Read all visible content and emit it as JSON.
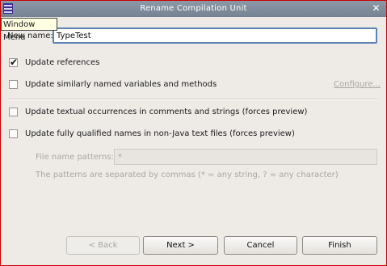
{
  "window": {
    "title": "Rename Compilation Unit",
    "menu_tooltip": "Window Menu",
    "close_glyph": "✕"
  },
  "form": {
    "new_name_label": "New name:",
    "new_name_value": "TypeTest",
    "options": [
      {
        "label": "Update references",
        "checked": true
      },
      {
        "label": "Update similarly named variables and methods",
        "checked": false
      },
      {
        "label": "Update textual occurrences in comments and strings (forces preview)",
        "checked": false
      },
      {
        "label": "Update fully qualified names in non-Java text files (forces preview)",
        "checked": false
      }
    ],
    "configure_link": "Configure...",
    "file_patterns_label": "File name patterns:",
    "file_patterns_value": "*",
    "patterns_hint": "The patterns are separated by commas (* = any string, ? = any character)"
  },
  "buttons": {
    "back": "< Back",
    "next": "Next >",
    "cancel": "Cancel",
    "finish": "Finish"
  },
  "icons": {
    "menu": "window-menu-icon",
    "close": "close-icon",
    "check": "checkmark-icon"
  }
}
